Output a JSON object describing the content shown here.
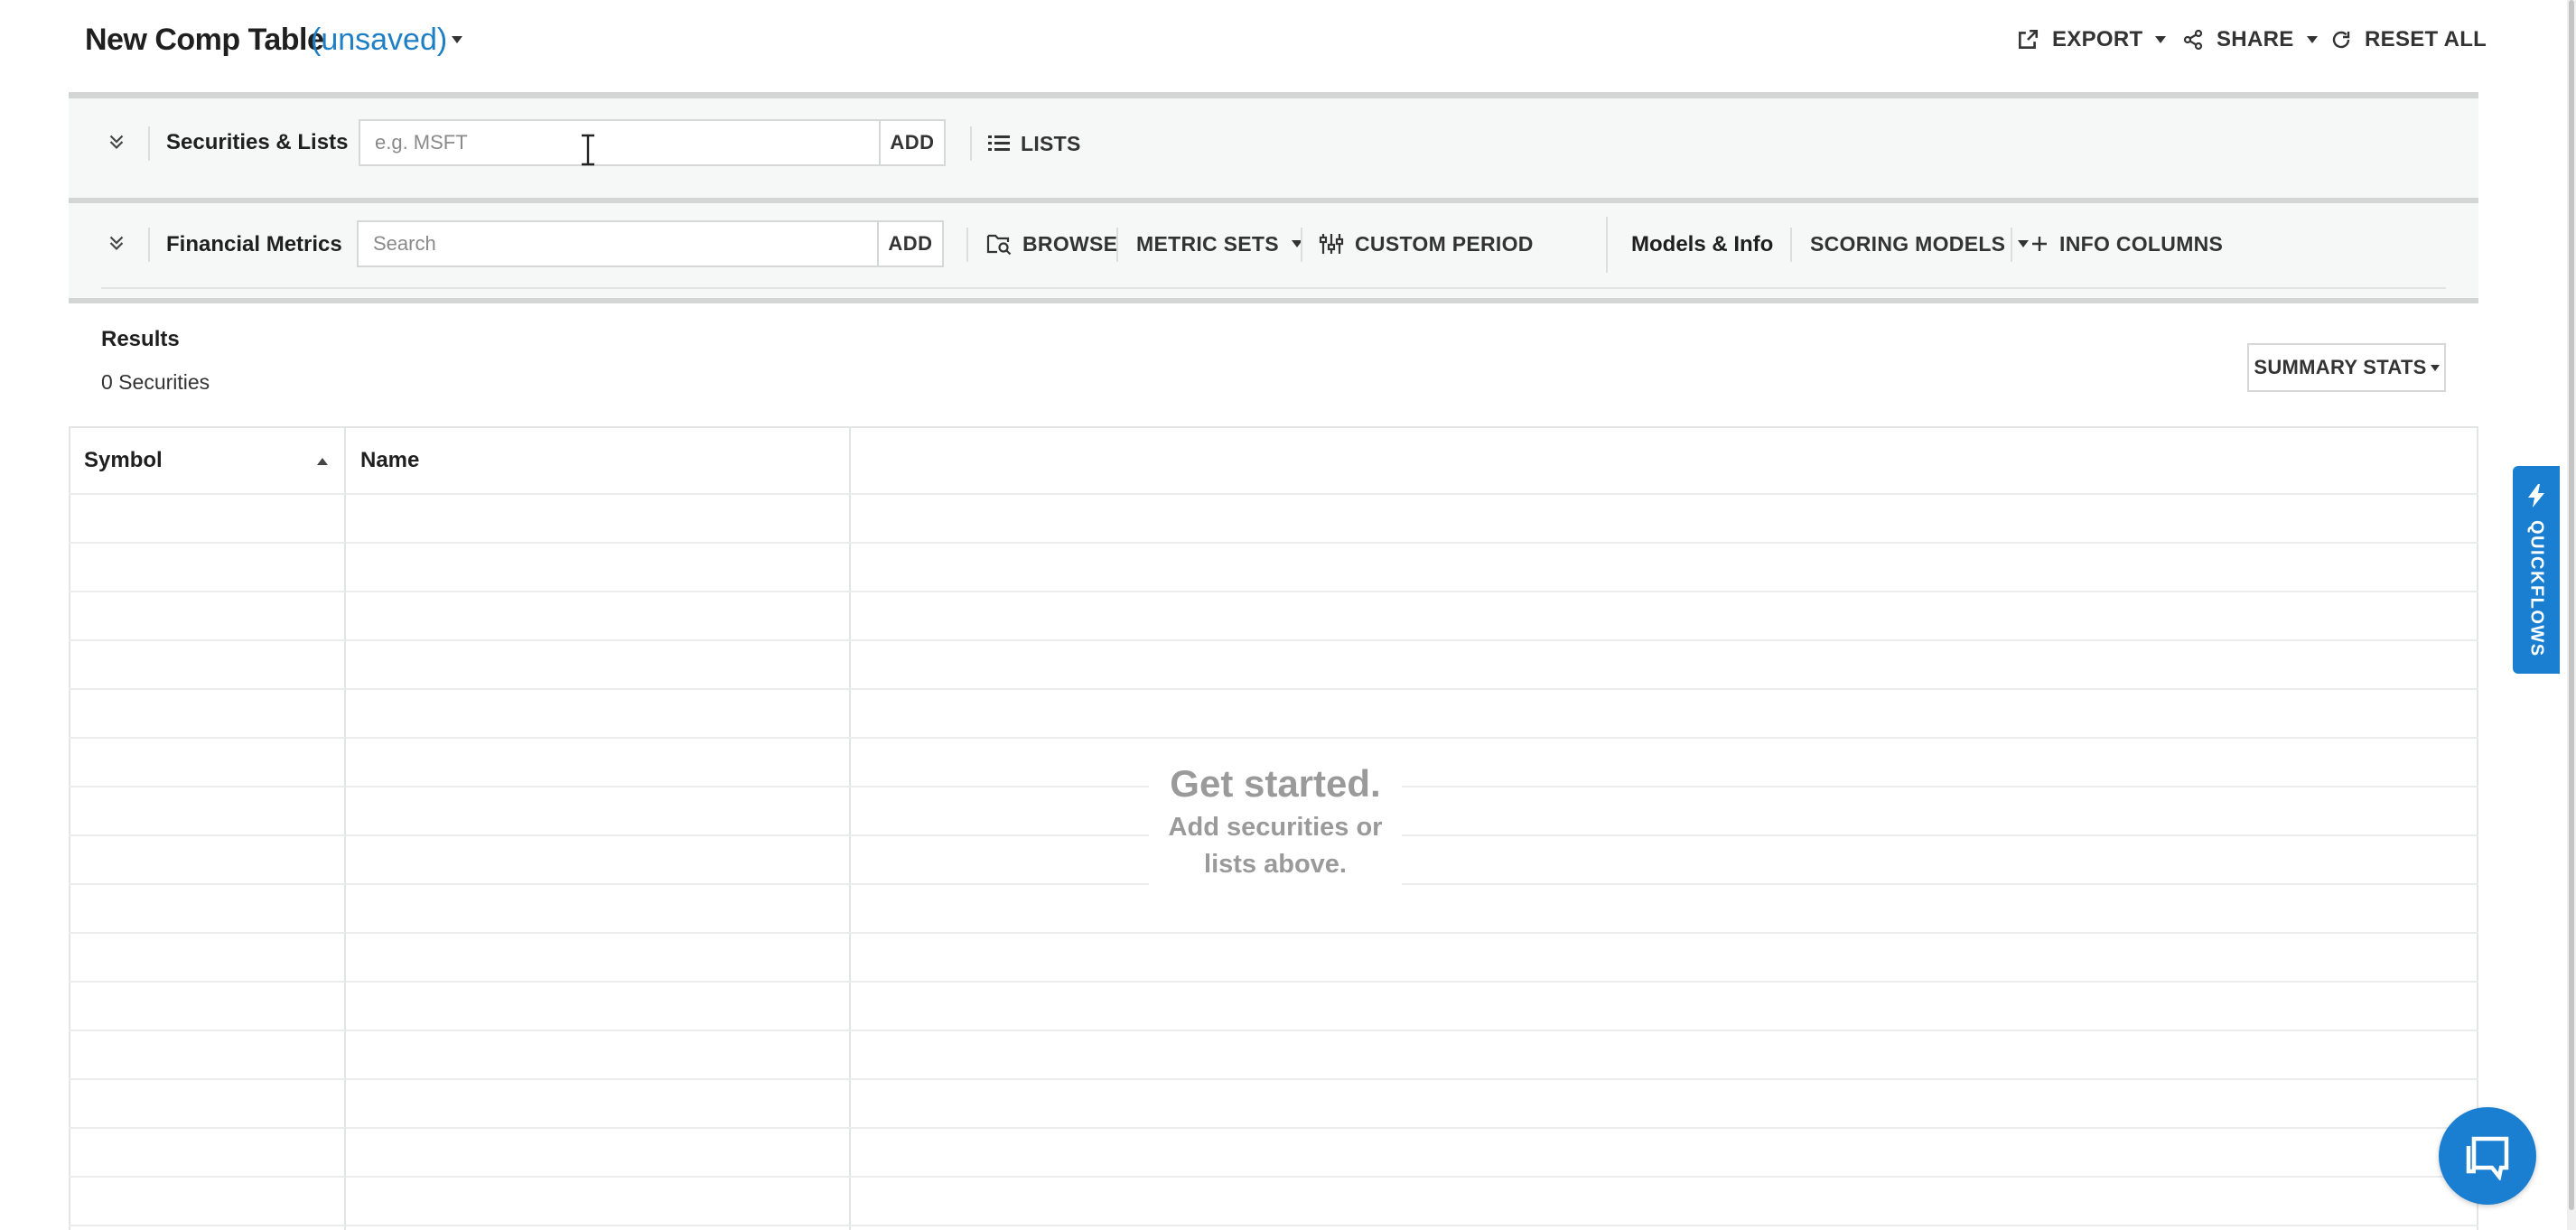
{
  "header": {
    "title": "New Comp Table",
    "status": "(unsaved)",
    "export_label": "EXPORT",
    "share_label": "SHARE",
    "reset_label": "RESET ALL"
  },
  "securities_row": {
    "label": "Securities & Lists",
    "input_placeholder": "e.g. MSFT",
    "add_label": "ADD",
    "lists_label": "LISTS"
  },
  "metrics_row": {
    "label": "Financial Metrics",
    "input_placeholder": "Search",
    "add_label": "ADD",
    "browse_label": "BROWSE",
    "metric_sets_label": "METRIC SETS",
    "custom_period_label": "CUSTOM PERIOD",
    "models_label": "Models & Info",
    "scoring_models_label": "SCORING MODELS",
    "info_columns_label": "INFO COLUMNS"
  },
  "results": {
    "label": "Results",
    "count": "0 Securities",
    "summary_stats_label": "SUMMARY STATS"
  },
  "table": {
    "columns": [
      "Symbol",
      "Name"
    ],
    "sort_column": "Symbol",
    "sort_direction": "ascending",
    "row_count": 0
  },
  "empty_state": {
    "title": "Get started.",
    "line1": "Add securities or",
    "line2": "lists above."
  },
  "side_tab": {
    "label": "QUICKFLOWS",
    "icon": "lightning-icon"
  },
  "chat": {
    "icon": "chat-bubble-icon"
  },
  "colors": {
    "accent": "#1a7fd1",
    "link": "#1f7fc4",
    "panel_bg": "#f6f7f7"
  }
}
